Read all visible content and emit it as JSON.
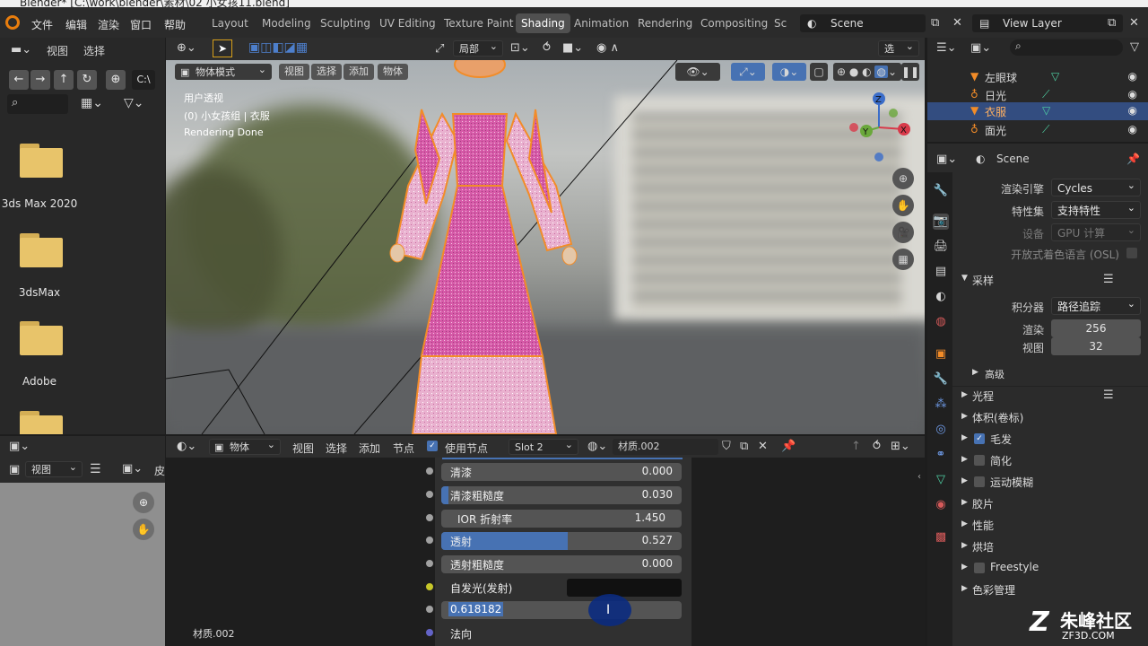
{
  "window": {
    "title": "Blender* [C:\\work\\blender\\素材\\02 小女孩11.blend]"
  },
  "menu": [
    "文件",
    "编辑",
    "渲染",
    "窗口",
    "帮助"
  ],
  "workspaces": [
    {
      "label": "Layout",
      "active": false
    },
    {
      "label": "Modeling",
      "active": false
    },
    {
      "label": "Sculpting",
      "active": false
    },
    {
      "label": "UV Editing",
      "active": false
    },
    {
      "label": "Texture Paint",
      "active": false
    },
    {
      "label": "Shading",
      "active": true
    },
    {
      "label": "Animation",
      "active": false
    },
    {
      "label": "Rendering",
      "active": false
    },
    {
      "label": "Compositing",
      "active": false
    },
    {
      "label": "Sc",
      "active": false
    }
  ],
  "scene_name": "Scene",
  "view_layer": "View Layer",
  "file_browser": {
    "header": [
      "视图",
      "选择"
    ],
    "path_btn": "C:\\",
    "folders": [
      "3ds Max 2020",
      "3dsMax",
      "Adobe",
      ""
    ]
  },
  "viewport_header": {
    "transform": "局部",
    "options": "选项",
    "mode": "物体模式",
    "menus": [
      "视图",
      "选择",
      "添加",
      "物体"
    ]
  },
  "viewport": {
    "info_line1": "用户透视",
    "info_line2": "(0) 小女孩组 | 衣服",
    "info_line3": "Rendering Done",
    "gizmo": {
      "x": "X",
      "y": "Y",
      "z": "Z"
    }
  },
  "node_editor": {
    "header_mode": "物体",
    "menus": [
      "视图",
      "选择",
      "添加",
      "节点"
    ],
    "use_nodes_label": "使用节点",
    "slot": "Slot 2",
    "material": "材质.002",
    "footer_label": "材质.002",
    "rows": [
      {
        "label": "清漆",
        "value": "0.000",
        "fill": 0.0,
        "socket": "#a1a1a1"
      },
      {
        "label": "清漆粗糙度",
        "value": "0.030",
        "fill": 0.03,
        "socket": "#a1a1a1"
      },
      {
        "label": "IOR 折射率",
        "value": "1.450",
        "fill": 0.0,
        "socket": "#a1a1a1"
      },
      {
        "label": "透射",
        "value": "0.527",
        "fill": 0.527,
        "socket": "#a1a1a1"
      },
      {
        "label": "透射粗糙度",
        "value": "0.000",
        "fill": 0.0,
        "socket": "#a1a1a1"
      }
    ],
    "emission_label": "自发光(发射)",
    "editing_value": "0.618182",
    "normal_label": "法向"
  },
  "image_editor": {
    "view_label": "视图",
    "overflow_label": "皮"
  },
  "outliner": {
    "rows": [
      {
        "label": "左眼球",
        "selected": false
      },
      {
        "label": "日光",
        "selected": false
      },
      {
        "label": "衣服",
        "selected": true
      },
      {
        "label": "面光",
        "selected": false
      }
    ]
  },
  "properties": {
    "scene_label": "Scene",
    "render_engine_label": "渲染引擎",
    "render_engine": "Cycles",
    "feature_set_label": "特性集",
    "feature_set": "支持特性",
    "device_label": "设备",
    "device": "GPU 计算",
    "osl_label": "开放式着色语言 (OSL)",
    "sampling_label": "采样",
    "integrator_label": "积分器",
    "integrator": "路径追踪",
    "render_samples_label": "渲染",
    "render_samples": "256",
    "viewport_samples_label": "视图",
    "viewport_samples": "32",
    "advanced_label": "高级",
    "panels": [
      {
        "label": "光程",
        "checkbox": null
      },
      {
        "label": "体积(卷标)",
        "checkbox": null
      },
      {
        "label": "毛发",
        "checkbox": true
      },
      {
        "label": "简化",
        "checkbox": false
      },
      {
        "label": "运动模糊",
        "checkbox": false
      },
      {
        "label": "胶片",
        "checkbox": null
      },
      {
        "label": "性能",
        "checkbox": null
      },
      {
        "label": "烘培",
        "checkbox": null
      },
      {
        "label": "Freestyle",
        "checkbox": false
      },
      {
        "label": "色彩管理",
        "checkbox": null
      }
    ]
  },
  "watermark": {
    "text": "朱峰社区",
    "sub": "ZF3D.COM"
  },
  "colors": {
    "accent": "#4772b3",
    "selection": "#334d80",
    "outline": "#f28c28"
  }
}
